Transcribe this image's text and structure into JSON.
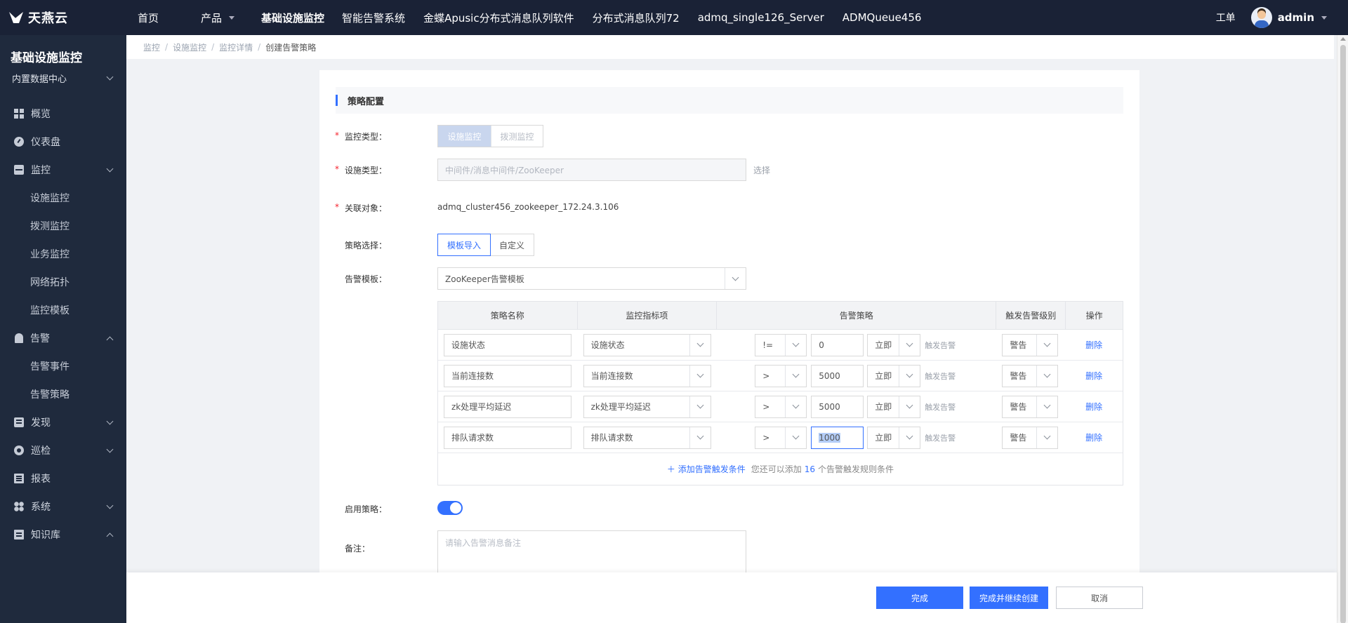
{
  "app": {
    "logo_text": "天燕云",
    "nav": [
      {
        "label": "首页"
      },
      {
        "label": "产品"
      },
      {
        "label": "基础设施监控"
      },
      {
        "label": "智能告警系统"
      },
      {
        "label": "金蝶Apusic分布式消息队列软件"
      },
      {
        "label": "分布式消息队列72"
      },
      {
        "label": "admq_single126_Server"
      },
      {
        "label": "ADMQueue456"
      }
    ],
    "ticket_label": "工单",
    "user_name": "admin"
  },
  "sidebar": {
    "title": "基础设施监控",
    "datacenter": "内置数据中心",
    "items": {
      "overview": "概览",
      "dashboard": "仪表盘",
      "monitor": "监控",
      "monitor_sub": [
        "设施监控",
        "拨测监控",
        "业务监控",
        "网络拓扑",
        "监控模板"
      ],
      "alert": "告警",
      "alert_sub": [
        "告警事件",
        "告警策略"
      ],
      "discover": "发现",
      "patrol": "巡检",
      "report": "报表",
      "system": "系统",
      "kb": "知识库"
    }
  },
  "breadcrumb": [
    "监控",
    "设施监控",
    "监控详情",
    "创建告警策略"
  ],
  "form": {
    "section_title": "策略配置",
    "monitor_type": {
      "label": "监控类型：",
      "options": [
        "设施监控",
        "拨测监控"
      ]
    },
    "facility_type": {
      "label": "设施类型：",
      "value": "中间件/消息中间件/ZooKeeper",
      "select_label": "选择"
    },
    "related_object": {
      "label": "关联对象：",
      "value": "admq_cluster456_zookeeper_172.24.3.106"
    },
    "strategy_choice": {
      "label": "策略选择：",
      "options": [
        "模板导入",
        "自定义"
      ]
    },
    "alert_template": {
      "label": "告警模板：",
      "value": "ZooKeeper告警模板"
    },
    "table": {
      "headers": [
        "策略名称",
        "监控指标项",
        "告警策略",
        "触发告警级别",
        "操作"
      ],
      "rows": [
        {
          "name": "设施状态",
          "metric": "设施状态",
          "op": "!=",
          "threshold": "0",
          "timing": "立即",
          "trigger": "触发告警",
          "level": "警告",
          "action": "删除"
        },
        {
          "name": "当前连接数",
          "metric": "当前连接数",
          "op": ">",
          "threshold": "5000",
          "timing": "立即",
          "trigger": "触发告警",
          "level": "警告",
          "action": "删除"
        },
        {
          "name": "zk处理平均延迟",
          "metric": "zk处理平均延迟",
          "op": ">",
          "threshold": "5000",
          "timing": "立即",
          "trigger": "触发告警",
          "level": "警告",
          "action": "删除"
        },
        {
          "name": "排队请求数",
          "metric": "排队请求数",
          "op": ">",
          "threshold": "1000",
          "timing": "立即",
          "trigger": "触发告警",
          "level": "警告",
          "action": "删除"
        }
      ],
      "add_label": "＋ 添加告警触发条件",
      "remaining_prefix": "您还可以添加",
      "remaining_count": "16",
      "remaining_suffix": "个告警触发规则条件"
    },
    "enable": {
      "label": "启用策略：",
      "on": true
    },
    "remark": {
      "label": "备注：",
      "placeholder": "请输入告警消息备注"
    }
  },
  "footer": {
    "finish": "完成",
    "finish_continue": "完成并继续创建",
    "cancel": "取消"
  },
  "colors": {
    "primary": "#3370ff",
    "topbar": "#1a2236",
    "sidebar": "#1f2a3d"
  }
}
